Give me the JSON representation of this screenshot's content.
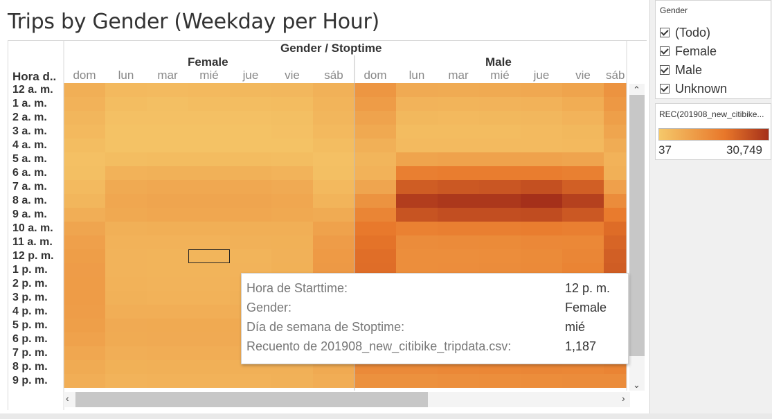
{
  "sheet_title": "Trips by Gender (Weekday per Hour)",
  "filter_card": {
    "title": "Gender",
    "options": [
      {
        "label": "(Todo)",
        "checked": true
      },
      {
        "label": "Female",
        "checked": true
      },
      {
        "label": "Male",
        "checked": true
      },
      {
        "label": "Unknown",
        "checked": true
      }
    ]
  },
  "legend_card": {
    "title": "REC(201908_new_citibike...",
    "min_label": "37",
    "max_label": "30,749",
    "color_low": "#f5c86a",
    "color_mid": "#e8772a",
    "color_high": "#a5301a"
  },
  "tooltip": {
    "rows": [
      {
        "key": "Hora de Starttime:",
        "value": "12 p. m."
      },
      {
        "key": "Gender:",
        "value": "Female"
      },
      {
        "key": "Día de semana de Stoptime:",
        "value": "mié"
      },
      {
        "key": "Recuento de 201908_new_citibike_tripdata.csv:",
        "value": "1,187"
      }
    ]
  },
  "chart_data": {
    "type": "heatmap",
    "title": "Trips by Gender (Weekday per Hour)",
    "column_header": "Gender / Stoptime",
    "row_header": "Hora d..",
    "groups": [
      {
        "name": "Female",
        "days": [
          "dom",
          "lun",
          "mar",
          "mié",
          "jue",
          "vie",
          "sáb"
        ]
      },
      {
        "name": "Male",
        "days": [
          "dom",
          "lun",
          "mar",
          "mié",
          "jue",
          "vie",
          "sáb"
        ]
      }
    ],
    "hours": [
      "12 a. m.",
      "1 a. m.",
      "2 a. m.",
      "3 a. m.",
      "4 a. m.",
      "5 a. m.",
      "6 a. m.",
      "7 a. m.",
      "8 a. m.",
      "9 a. m.",
      "10 a. m.",
      "11 a. m.",
      "12 p. m.",
      "1 p. m.",
      "2 p. m.",
      "3 p. m.",
      "4 p. m.",
      "5 p. m.",
      "6 p. m.",
      "7 p. m.",
      "8 p. m.",
      "9 p. m."
    ],
    "color_range": [
      37,
      30749
    ],
    "values": {
      "Female": [
        [
          1900,
          800,
          700,
          800,
          900,
          1000,
          1600
        ],
        [
          1500,
          500,
          400,
          500,
          500,
          600,
          1300
        ],
        [
          1100,
          300,
          300,
          300,
          300,
          400,
          1100
        ],
        [
          800,
          200,
          200,
          200,
          200,
          300,
          800
        ],
        [
          500,
          200,
          200,
          200,
          200,
          200,
          500
        ],
        [
          300,
          500,
          600,
          600,
          600,
          500,
          300
        ],
        [
          400,
          1500,
          1600,
          1600,
          1600,
          1400,
          400
        ],
        [
          700,
          2600,
          2800,
          2800,
          2800,
          2500,
          800
        ],
        [
          1100,
          3000,
          3200,
          3200,
          3200,
          2900,
          1300
        ],
        [
          2000,
          2700,
          2900,
          2900,
          2900,
          2700,
          2400
        ],
        [
          3200,
          1800,
          1900,
          1900,
          1900,
          1900,
          3800
        ],
        [
          4000,
          1500,
          1500,
          1500,
          1600,
          1700,
          4700
        ],
        [
          4500,
          1400,
          1300,
          1187,
          1300,
          1600,
          5200
        ],
        [
          4700,
          1400,
          1300,
          1300,
          1400,
          1700,
          5400
        ],
        [
          4800,
          1500,
          1400,
          1400,
          1500,
          1800,
          5400
        ],
        [
          4800,
          1600,
          1500,
          1500,
          1600,
          2000,
          5300
        ],
        [
          4600,
          2000,
          2000,
          2000,
          2000,
          2300,
          5000
        ],
        [
          4300,
          2500,
          2600,
          2600,
          2600,
          2700,
          4600
        ],
        [
          3800,
          2400,
          2500,
          2500,
          2500,
          2500,
          4100
        ],
        [
          3000,
          2000,
          2100,
          2100,
          2100,
          2100,
          3300
        ],
        [
          2400,
          1700,
          1800,
          1800,
          1800,
          1800,
          2600
        ],
        [
          2000,
          1400,
          1500,
          1500,
          1500,
          1600,
          2100
        ]
      ],
      "Male": [
        [
          6000,
          2500,
          2400,
          2600,
          2800,
          3500,
          6500
        ],
        [
          4800,
          1400,
          1300,
          1400,
          1500,
          2200,
          5600
        ],
        [
          3600,
          900,
          800,
          900,
          1000,
          1400,
          4300
        ],
        [
          2700,
          600,
          600,
          600,
          700,
          900,
          3300
        ],
        [
          1800,
          700,
          700,
          700,
          700,
          800,
          2300
        ],
        [
          1200,
          3500,
          3700,
          3700,
          3700,
          3400,
          1500
        ],
        [
          1500,
          11000,
          11500,
          11500,
          11500,
          10800,
          1800
        ],
        [
          3200,
          19000,
          20000,
          20500,
          22000,
          18500,
          4000
        ],
        [
          6500,
          27000,
          28500,
          28500,
          30749,
          26000,
          8000
        ],
        [
          9500,
          21000,
          22500,
          22500,
          23000,
          20000,
          12000
        ],
        [
          12500,
          10500,
          11000,
          11000,
          11500,
          11000,
          15500
        ],
        [
          14000,
          8000,
          8200,
          8300,
          8800,
          9000,
          17000
        ],
        [
          15000,
          7500,
          7600,
          7800,
          8300,
          9300,
          18500
        ],
        [
          15200,
          7600,
          7700,
          7900,
          8500,
          9800,
          19000
        ],
        [
          15000,
          8000,
          8100,
          8300,
          8900,
          10500,
          19200
        ],
        [
          14800,
          9000,
          9100,
          9300,
          9900,
          11500,
          18800
        ],
        [
          14500,
          12000,
          12500,
          12700,
          13300,
          14000,
          17800
        ],
        [
          13800,
          15000,
          15800,
          16000,
          16500,
          15500,
          16500
        ],
        [
          12500,
          13800,
          14500,
          14800,
          15000,
          14000,
          14800
        ],
        [
          10500,
          11000,
          11500,
          11800,
          12000,
          11500,
          12500
        ],
        [
          8500,
          8500,
          9000,
          9200,
          9400,
          9200,
          9800
        ],
        [
          7000,
          7000,
          7300,
          7500,
          7800,
          7900,
          8000
        ]
      ]
    },
    "highlighted_cell": {
      "gender": "Female",
      "day": "mié",
      "hour": "12 p. m."
    }
  }
}
